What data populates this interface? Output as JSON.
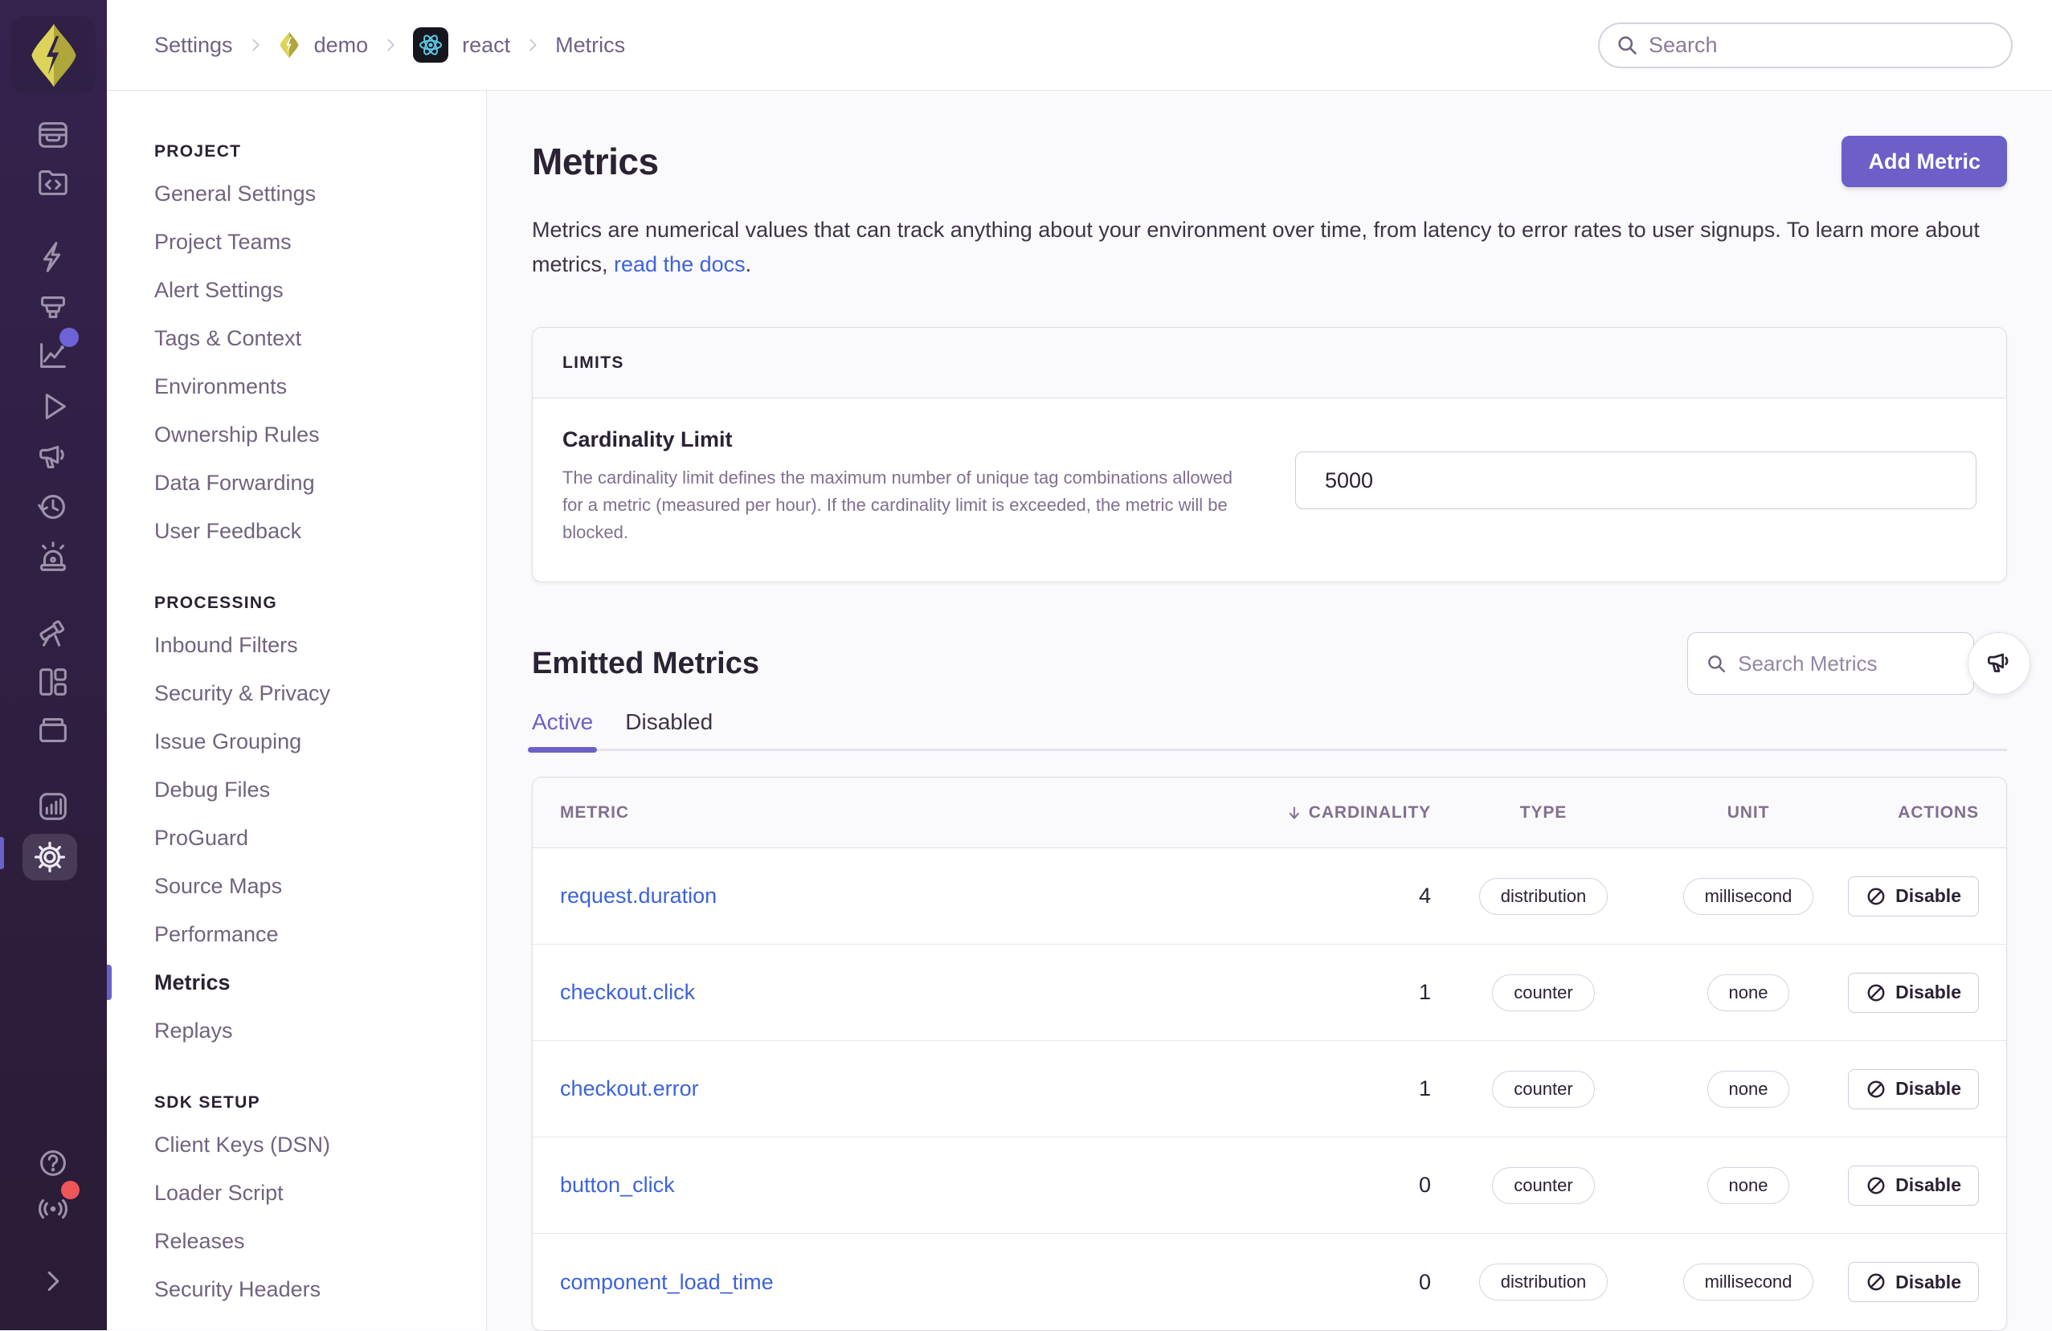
{
  "theme": {
    "accent": "#6C5FC7",
    "link": "#3D63DB",
    "red": "#F0555A",
    "sidebar_top": "#34234d",
    "sidebar_bottom": "#2a1b36",
    "logo_lime": "#D8CF4E"
  },
  "breadcrumb": {
    "items": [
      {
        "label": "Settings",
        "icon": null
      },
      {
        "label": "demo",
        "icon": "sentry-diamond"
      },
      {
        "label": "react",
        "icon": "react"
      },
      {
        "label": "Metrics",
        "icon": null
      }
    ]
  },
  "topbar": {
    "search_placeholder": "Search"
  },
  "icon_rail": {
    "icons": [
      "issues",
      "projects",
      "performance",
      "traces",
      "metrics-chart",
      "replays-play",
      "feedback-megaphone",
      "history-clock",
      "alerts-siren",
      "discover-telescope",
      "dashboards-grid",
      "stats-archive",
      "reports-chart",
      "settings-gear",
      "help",
      "whats-new-broadcast",
      "collapse-chevron"
    ],
    "badges": {
      "metrics_new_dot": true,
      "whats_new_dot": true
    },
    "active": "settings-gear"
  },
  "settings_nav": {
    "sections": [
      {
        "heading": "PROJECT",
        "items": [
          {
            "label": "General Settings",
            "active": false
          },
          {
            "label": "Project Teams",
            "active": false
          },
          {
            "label": "Alert Settings",
            "active": false
          },
          {
            "label": "Tags & Context",
            "active": false
          },
          {
            "label": "Environments",
            "active": false
          },
          {
            "label": "Ownership Rules",
            "active": false
          },
          {
            "label": "Data Forwarding",
            "active": false
          },
          {
            "label": "User Feedback",
            "active": false
          }
        ]
      },
      {
        "heading": "PROCESSING",
        "items": [
          {
            "label": "Inbound Filters",
            "active": false
          },
          {
            "label": "Security & Privacy",
            "active": false
          },
          {
            "label": "Issue Grouping",
            "active": false
          },
          {
            "label": "Debug Files",
            "active": false
          },
          {
            "label": "ProGuard",
            "active": false
          },
          {
            "label": "Source Maps",
            "active": false
          },
          {
            "label": "Performance",
            "active": false
          },
          {
            "label": "Metrics",
            "active": true
          },
          {
            "label": "Replays",
            "active": false
          }
        ]
      },
      {
        "heading": "SDK SETUP",
        "items": [
          {
            "label": "Client Keys (DSN)",
            "active": false
          },
          {
            "label": "Loader Script",
            "active": false
          },
          {
            "label": "Releases",
            "active": false
          },
          {
            "label": "Security Headers",
            "active": false
          }
        ]
      }
    ]
  },
  "main": {
    "title": "Metrics",
    "add_button": "Add Metric",
    "description_text": "Metrics are numerical values that can track anything about your environment over time, from latency to error rates to user signups. To learn more about metrics, ",
    "description_link": "read the docs",
    "description_suffix": ".",
    "limits": {
      "heading": "LIMITS",
      "field_label": "Cardinality Limit",
      "field_help": "The cardinality limit defines the maximum number of unique tag combinations allowed for a metric (measured per hour). If the cardinality limit is exceeded, the metric will be blocked.",
      "input_value": "5000"
    },
    "emitted": {
      "heading": "Emitted Metrics",
      "search_placeholder": "Search Metrics",
      "tabs": [
        {
          "label": "Active",
          "active": true
        },
        {
          "label": "Disabled",
          "active": false
        }
      ],
      "table": {
        "headers": {
          "metric": "METRIC",
          "cardinality": "CARDINALITY",
          "type": "TYPE",
          "unit": "UNIT",
          "actions": "ACTIONS"
        },
        "sorted_by": "CARDINALITY",
        "sort_direction": "desc",
        "action_label": "Disable",
        "rows": [
          {
            "metric": "request.duration",
            "cardinality": "4",
            "type": "distribution",
            "unit": "millisecond"
          },
          {
            "metric": "checkout.click",
            "cardinality": "1",
            "type": "counter",
            "unit": "none"
          },
          {
            "metric": "checkout.error",
            "cardinality": "1",
            "type": "counter",
            "unit": "none"
          },
          {
            "metric": "button_click",
            "cardinality": "0",
            "type": "counter",
            "unit": "none"
          },
          {
            "metric": "component_load_time",
            "cardinality": "0",
            "type": "distribution",
            "unit": "millisecond"
          }
        ]
      }
    }
  }
}
